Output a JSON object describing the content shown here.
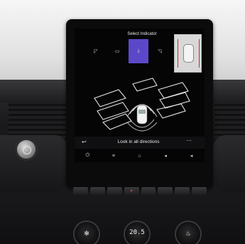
{
  "screen": {
    "title": "Select Indicator",
    "camera_tabs": [
      {
        "icon": "front-left-camera-icon",
        "glyph": "◸",
        "active": false
      },
      {
        "icon": "front-camera-icon",
        "glyph": "▭",
        "active": false
      },
      {
        "icon": "rear-camera-icon",
        "glyph": "⤓",
        "active": true
      },
      {
        "icon": "right-camera-icon",
        "glyph": "◹",
        "active": false
      }
    ],
    "menu_label": "Look in all directions",
    "back_glyph": "↩",
    "more_glyph": "⋯",
    "nav_items": [
      {
        "icon": "power-icon",
        "glyph": "⏻"
      },
      {
        "icon": "menu-icon",
        "glyph": "≡"
      },
      {
        "icon": "home-icon",
        "glyph": "⌂"
      },
      {
        "icon": "volume-down-icon",
        "glyph": "◂"
      },
      {
        "icon": "volume-up-icon",
        "glyph": "◂"
      }
    ],
    "accent_color": "#5b48c9"
  },
  "console": {
    "climate_readout": "20.5",
    "left_knob_glyph": "✻",
    "right_knob_glyph": "♨"
  }
}
